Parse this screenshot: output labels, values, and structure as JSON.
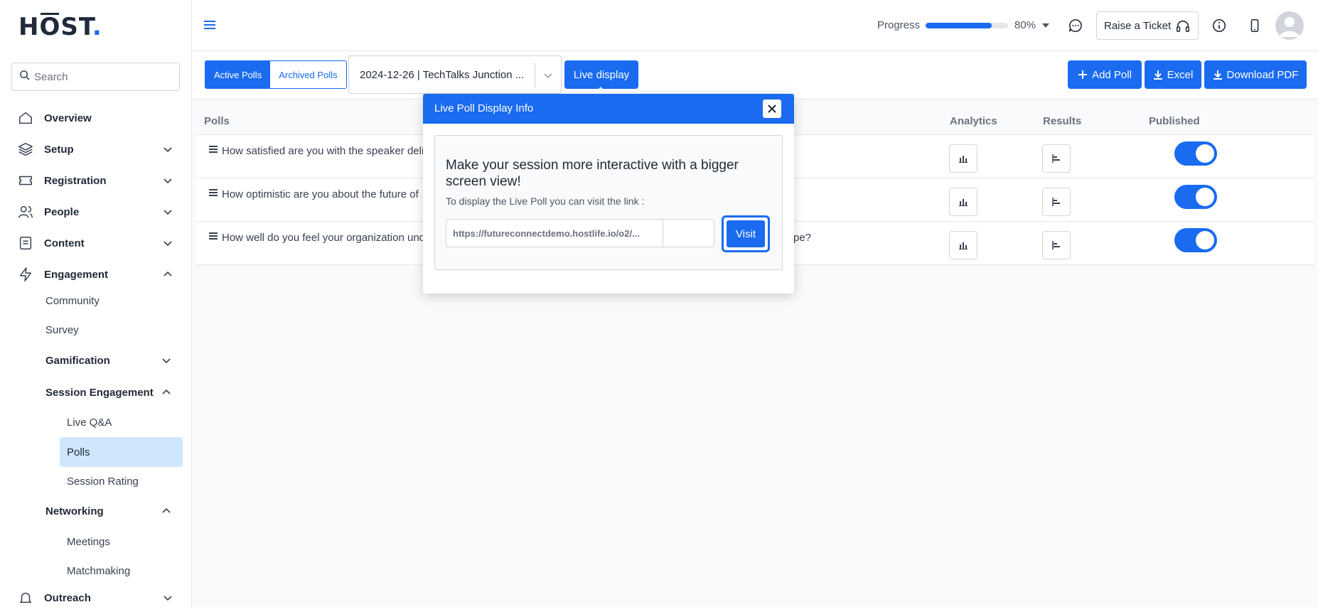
{
  "brand": {
    "logo_h": "H",
    "logo_o": "O",
    "logo_rest": "ST",
    "logo_dot": "."
  },
  "sidebar": {
    "search_placeholder": "Search",
    "items": [
      {
        "label": "Overview",
        "icon": "home-icon"
      },
      {
        "label": "Setup",
        "icon": "layers-icon"
      },
      {
        "label": "Registration",
        "icon": "ticket-icon"
      },
      {
        "label": "People",
        "icon": "users-icon"
      },
      {
        "label": "Content",
        "icon": "document-icon"
      },
      {
        "label": "Engagement",
        "icon": "lightning-icon"
      }
    ],
    "engagement_sub": {
      "community": "Community",
      "survey": "Survey",
      "gamification": "Gamification",
      "session_engagement": "Session Engagement",
      "live_qa": "Live Q&A",
      "polls": "Polls",
      "session_rating": "Session Rating",
      "networking": "Networking",
      "meetings": "Meetings",
      "matchmaking": "Matchmaking"
    },
    "outreach": "Outreach"
  },
  "header": {
    "progress_label": "Progress",
    "progress_value": 80,
    "progress_text": "80%",
    "raise_ticket": "Raise a Ticket"
  },
  "toolbar": {
    "tab_active": "Active Polls",
    "tab_archived": "Archived Polls",
    "session_value": "2024-12-26 | TechTalks Junction ...",
    "live_display": "Live display",
    "add_poll": "Add Poll",
    "excel": "Excel",
    "download_pdf": "Download PDF"
  },
  "table": {
    "headers": {
      "polls": "Polls",
      "analytics": "Analytics",
      "results": "Results",
      "published": "Published"
    },
    "rows": [
      {
        "question_start": "How satisfied are you with the speaker deli",
        "question_end": "",
        "published": true
      },
      {
        "question_start": "How optimistic are you about the future of",
        "question_end": "",
        "published": true
      },
      {
        "question_start": "How well do you feel your organization und",
        "question_end": "pe?",
        "published": true
      }
    ]
  },
  "modal": {
    "title": "Live Poll Display Info",
    "heading": "Make your session more interactive with a bigger screen view!",
    "text": "To display the Live Poll you can visit the link :",
    "url": "https://futureconnectdemo.hostlife.io/o2/...",
    "visit": "Visit"
  },
  "colors": {
    "accent": "#1a6bf0",
    "active_nav": "#cfe6fb"
  }
}
